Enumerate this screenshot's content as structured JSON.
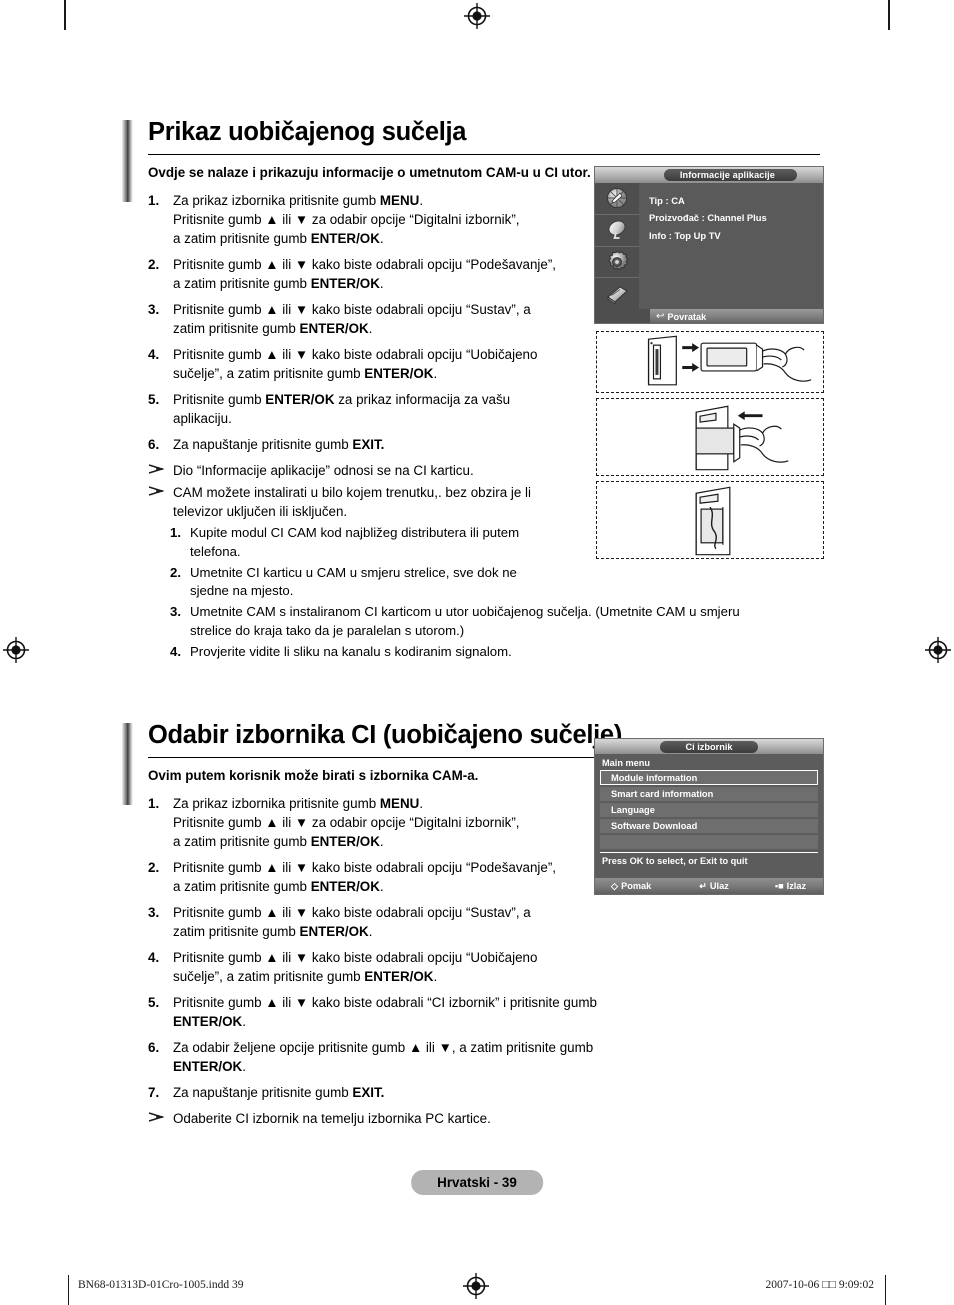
{
  "document": {
    "page_badge": "Hrvatski - 39",
    "footer_left": "BN68-01313D-01Cro-1005.indd   39",
    "footer_right": "2007-10-06   □□ 9:09:02"
  },
  "section1": {
    "heading": "Prikaz uobičajenog sučelja",
    "lead": "Ovdje se nalaze i prikazuju informacije o umetnutom CAM-u u CI utor.",
    "steps": [
      {
        "num": "1.",
        "html": "Za prikaz izbornika pritisnite gumb <b>MENU</b>.<br>Pritisnite gumb ▲ ili ▼ za odabir opcije “Digitalni izbornik”,<br>a zatim pritisnite gumb <b>ENTER/OK</b>."
      },
      {
        "num": "2.",
        "html": "Pritisnite gumb ▲ ili ▼ kako biste odabrali opciju “Podešavanje”,<br>a zatim pritisnite gumb <b>ENTER/OK</b>."
      },
      {
        "num": "3.",
        "html": "Pritisnite gumb ▲ ili ▼ kako biste odabrali opciju “Sustav”, a<br>zatim pritisnite gumb <b>ENTER/OK</b>."
      },
      {
        "num": "4.",
        "html": "Pritisnite gumb ▲ ili ▼ kako biste odabrali opciju “Uobičajeno<br>sučelje”, a zatim pritisnite gumb <b>ENTER/OK</b>."
      },
      {
        "num": "5.",
        "html": "Pritisnite gumb <b>ENTER/OK</b> za prikaz informacija za vašu<br>aplikaciju."
      },
      {
        "num": "6.",
        "html": "Za napuštanje pritisnite gumb <b>EXIT.</b>"
      }
    ],
    "notes": [
      {
        "html": "Dio “Informacije aplikacije” odnosi se na CI karticu."
      },
      {
        "html": "CAM možete instalirati u bilo kojem trenutku,. bez obzira je li<br>televizor uključen ili isključen."
      }
    ],
    "sub_steps": [
      {
        "num": "1.",
        "html": "Kupite modul CI CAM kod najbližeg distributera ili putem<br>telefona."
      },
      {
        "num": "2.",
        "html": "Umetnite CI karticu u CAM u smjeru strelice, sve dok ne<br>sjedne na mjesto."
      },
      {
        "num": "3.",
        "html": "Umetnite CAM s instaliranom CI karticom u utor uobičajenog sučelja. (Umetnite CAM u smjeru<br>strelice do kraja tako da je paralelan s utorom.)"
      },
      {
        "num": "4.",
        "html": "Provjerite vidite li sliku na kanalu s kodiranim signalom."
      }
    ]
  },
  "section2": {
    "heading": "Odabir izbornika CI (uobičajeno sučelje)",
    "lead": "Ovim putem korisnik može birati s izbornika CAM-a.",
    "steps": [
      {
        "num": "1.",
        "html": "Za prikaz izbornika pritisnite gumb <b>MENU</b>.<br>Pritisnite gumb ▲ ili ▼ za odabir opcije “Digitalni izbornik”,<br>a zatim pritisnite gumb <b>ENTER/OK</b>."
      },
      {
        "num": "2.",
        "html": "Pritisnite gumb ▲ ili ▼ kako biste odabrali opciju “Podešavanje”,<br>a zatim pritisnite gumb <b>ENTER/OK</b>."
      },
      {
        "num": "3.",
        "html": "Pritisnite gumb ▲ ili ▼ kako biste odabrali opciju “Sustav”, a<br>zatim pritisnite gumb <b>ENTER/OK</b>."
      },
      {
        "num": "4.",
        "html": "Pritisnite gumb ▲ ili ▼ kako biste odabrali opciju “Uobičajeno<br>sučelje”, a zatim pritisnite gumb <b>ENTER/OK</b>."
      },
      {
        "num": "5.",
        "html": "Pritisnite gumb ▲ ili ▼ kako biste odabrali “CI izbornik” i pritisnite gumb <b>ENTER/OK</b>."
      },
      {
        "num": "6.",
        "html": "Za odabir željene opcije pritisnite gumb ▲ ili ▼, a zatim pritisnite gumb <b>ENTER/OK</b>."
      },
      {
        "num": "7.",
        "html": "Za napuštanje pritisnite gumb <b>EXIT.</b>"
      }
    ],
    "notes": [
      {
        "html": "Odaberite CI izbornik na temelju izbornika PC kartice."
      }
    ]
  },
  "osd_app_info": {
    "title": "Informacije aplikacije",
    "lines": [
      "Tip : CA",
      "Proizvođač : Channel Plus",
      "Info : Top Up TV"
    ],
    "footer_back": "Povratak",
    "icons": [
      "antenna-icon",
      "satellite-dish-icon",
      "setup-gear-icon",
      "ci-module-icon"
    ]
  },
  "osd_ci_menu": {
    "title": "Ci izbornik",
    "main_menu_label": "Main menu",
    "items": [
      {
        "label": "Module information",
        "selected": true
      },
      {
        "label": "Smart card information",
        "selected": false
      },
      {
        "label": "Language",
        "selected": false
      },
      {
        "label": "Software Download",
        "selected": false
      },
      {
        "label": "",
        "selected": false
      }
    ],
    "hint": "Press OK to select, or Exit to quit",
    "footer": [
      {
        "icon": "move-diamond-icon",
        "label": "Pomak"
      },
      {
        "icon": "enter-icon",
        "label": "Ulaz"
      },
      {
        "icon": "exit-icon",
        "label": "Izlaz"
      }
    ]
  },
  "illustrations": [
    {
      "name": "cam-card-insert-step",
      "caption": ""
    },
    {
      "name": "cam-into-slot-step",
      "caption": ""
    },
    {
      "name": "cam-seated-step",
      "caption": ""
    }
  ]
}
